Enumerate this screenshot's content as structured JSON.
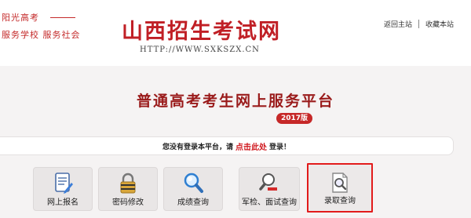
{
  "header": {
    "slogan_line1": "阳光高考",
    "slogan_line2": "服务学校  服务社会",
    "site_title": "山西招生考试网",
    "site_url": "HTTP://WWW.SXKSZX.CN",
    "links": [
      {
        "label": "返回主站"
      },
      {
        "label": "收藏本站"
      }
    ]
  },
  "main": {
    "platform_title": "普通高考考生网上服务平台",
    "version_badge": "2017版",
    "notice": {
      "prefix": "您没有登录本平台，请",
      "link": "点击此处",
      "suffix": "登录！"
    },
    "tiles": [
      {
        "label": "网上报名",
        "icon": "register-form-icon"
      },
      {
        "label": "密码修改",
        "icon": "lock-icon"
      },
      {
        "label": "成绩查询",
        "icon": "magnifier-icon"
      },
      {
        "label": "军检、面试查询",
        "icon": "magnifier-minus-icon"
      },
      {
        "label": "录取查询",
        "icon": "document-search-icon"
      }
    ]
  },
  "colors": {
    "brand_red": "#c01f25",
    "highlight_border": "#e21b1b"
  }
}
